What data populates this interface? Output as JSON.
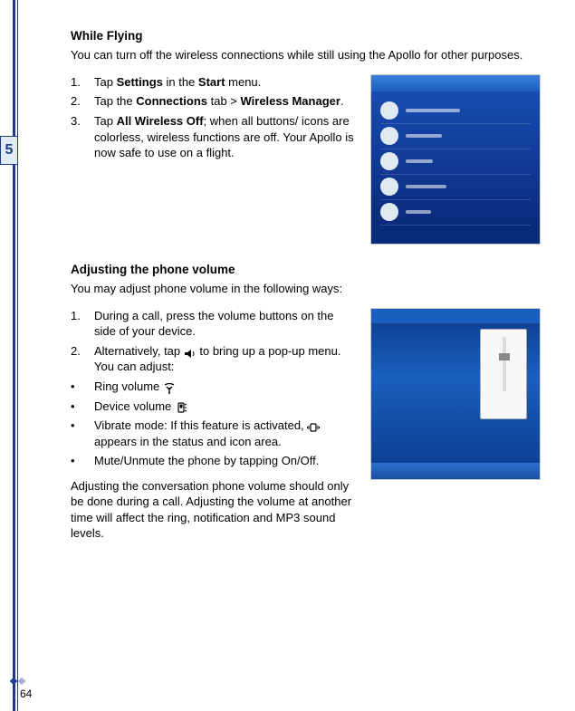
{
  "chapter_number": "5",
  "page_number": "64",
  "section1": {
    "heading": "While Flying",
    "intro": "You can turn off the wireless connections while still using the Apollo for other purposes.",
    "steps": [
      {
        "num": "1.",
        "pre": "Tap ",
        "b1": "Settings",
        "mid": " in the ",
        "b2": "Start",
        "post": " menu."
      },
      {
        "num": "2.",
        "pre": "Tap the ",
        "b1": "Connections",
        "mid": " tab > ",
        "b2": "Wireless Manager",
        "post": "."
      },
      {
        "num": "3.",
        "pre": "Tap ",
        "b1": "All Wireless Off",
        "mid": "",
        "b2": "",
        "post": "; when all buttons/ icons are colorless, wireless functions are off. Your Apollo is now safe to use on a flight."
      }
    ]
  },
  "section2": {
    "heading": "Adjusting the phone volume",
    "intro": "You may adjust phone volume in the following ways:",
    "steps": [
      {
        "num": "1.",
        "text": "During a call, press the volume buttons on the side of your device."
      },
      {
        "num": "2.",
        "pre": "Alternatively, tap ",
        "post": " to bring up a pop-up menu. You can adjust:"
      }
    ],
    "bullets": [
      {
        "label": "Ring volume ",
        "icon": "antenna"
      },
      {
        "label": "Device volume ",
        "icon": "phone"
      },
      {
        "label_pre": "Vibrate mode: If this feature is activated, ",
        "label_post": " appears in the status and icon area.",
        "icon": "vibrate"
      },
      {
        "label": "Mute/Unmute the phone by tapping On/Off."
      }
    ],
    "note": "Adjusting the conversation phone volume should only be done during a call. Adjusting the volume at another time will affect the ring, notification and MP3 sound levels."
  }
}
